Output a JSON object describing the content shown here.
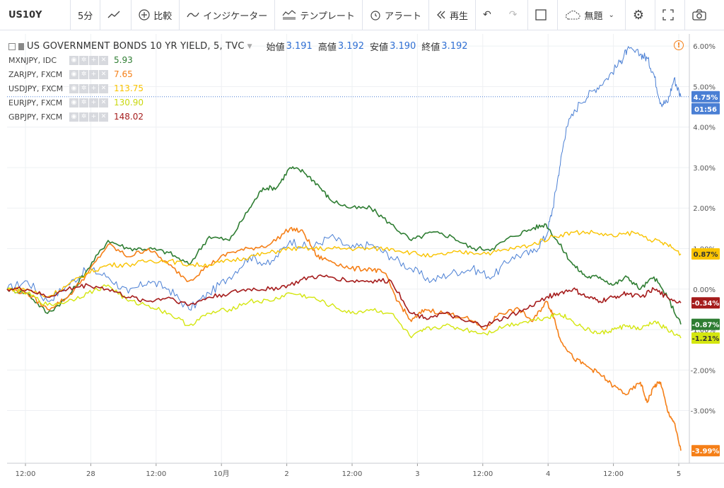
{
  "toolbar": {
    "symbol": "US10Y",
    "interval": "5分",
    "compare": "比較",
    "indicators": "インジケーター",
    "templates": "テンプレート",
    "alert": "アラート",
    "replay": "再生",
    "layout": "無題"
  },
  "legend": {
    "title": "US GOVERNMENT BONDS 10 YR YIELD, 5, TVC",
    "open_label": "始値",
    "open": "3.191",
    "high_label": "高値",
    "high": "3.192",
    "low_label": "安値",
    "low": "3.190",
    "close_label": "終値",
    "close": "3.192"
  },
  "comparisons": [
    {
      "name": "MXNJPY, IDC",
      "value": "5.93",
      "color": "#2e7d32"
    },
    {
      "name": "ZARJPY, FXCM",
      "value": "7.65",
      "color": "#f57f17"
    },
    {
      "name": "USDJPY, FXCM",
      "value": "113.75",
      "color": "#f9c300"
    },
    {
      "name": "EURJPY, FXCM",
      "value": "130.90",
      "color": "#d4e60f"
    },
    {
      "name": "GBPJPY, FXCM",
      "value": "148.02",
      "color": "#a51c1c"
    }
  ],
  "chart_data": {
    "type": "line",
    "x_ticks": [
      "12:00",
      "28",
      "12:00",
      "10月",
      "2",
      "12:00",
      "3",
      "12:00",
      "4",
      "12:00",
      "5"
    ],
    "y_ticks": [
      "6.00%",
      "5.00%",
      "4.00%",
      "3.00%",
      "2.00%",
      "1.00%",
      "0.00%",
      "-1.00%",
      "-2.00%",
      "-3.00%"
    ],
    "ylim": [
      -4.3,
      6.3
    ],
    "xlim": [
      0,
      100
    ],
    "badges": {
      "last_price_time": "01:56"
    },
    "series": [
      {
        "key": "us10y",
        "color": "#4a7fd4",
        "width": 1,
        "last_label": "4.75%",
        "points": [
          [
            0,
            0
          ],
          [
            3,
            0.2
          ],
          [
            6,
            -0.3
          ],
          [
            9,
            0.1
          ],
          [
            12,
            0.5
          ],
          [
            15,
            0.3
          ],
          [
            18,
            -0.1
          ],
          [
            21,
            0.2
          ],
          [
            24,
            0.0
          ],
          [
            27,
            -0.5
          ],
          [
            30,
            -0.1
          ],
          [
            33,
            0.3
          ],
          [
            36,
            0.8
          ],
          [
            39,
            0.6
          ],
          [
            42,
            1.2
          ],
          [
            45,
            1.0
          ],
          [
            48,
            1.3
          ],
          [
            51,
            1.0
          ],
          [
            54,
            1.1
          ],
          [
            57,
            0.8
          ],
          [
            60,
            0.5
          ],
          [
            63,
            0.2
          ],
          [
            66,
            0.4
          ],
          [
            69,
            0.5
          ],
          [
            72,
            0.3
          ],
          [
            75,
            0.8
          ],
          [
            78,
            0.9
          ],
          [
            80,
            1.3
          ],
          [
            81,
            2.0
          ],
          [
            82,
            3.0
          ],
          [
            83,
            4.0
          ],
          [
            85,
            4.6
          ],
          [
            87,
            4.9
          ],
          [
            89,
            5.2
          ],
          [
            91,
            5.6
          ],
          [
            92,
            5.9
          ],
          [
            94,
            5.8
          ],
          [
            95,
            5.7
          ],
          [
            96,
            5.3
          ],
          [
            97,
            4.6
          ],
          [
            98,
            4.6
          ],
          [
            99,
            5.2
          ],
          [
            100,
            4.75
          ]
        ]
      },
      {
        "key": "mxnjpy",
        "color": "#2e7d32",
        "width": 1.6,
        "last_label": "-0.87%",
        "points": [
          [
            0,
            0
          ],
          [
            3,
            -0.1
          ],
          [
            6,
            -0.6
          ],
          [
            9,
            -0.2
          ],
          [
            12,
            0.5
          ],
          [
            15,
            1.2
          ],
          [
            18,
            1.0
          ],
          [
            21,
            1.0
          ],
          [
            24,
            0.9
          ],
          [
            27,
            0.6
          ],
          [
            30,
            1.3
          ],
          [
            33,
            1.2
          ],
          [
            36,
            2.0
          ],
          [
            38,
            2.5
          ],
          [
            40,
            2.5
          ],
          [
            42,
            3.0
          ],
          [
            44,
            2.9
          ],
          [
            46,
            2.6
          ],
          [
            48,
            2.2
          ],
          [
            51,
            2.0
          ],
          [
            54,
            2.0
          ],
          [
            57,
            1.6
          ],
          [
            60,
            1.2
          ],
          [
            63,
            1.4
          ],
          [
            66,
            1.3
          ],
          [
            69,
            1.0
          ],
          [
            72,
            1.0
          ],
          [
            75,
            1.3
          ],
          [
            78,
            1.5
          ],
          [
            80,
            1.6
          ],
          [
            82,
            1.1
          ],
          [
            84,
            0.6
          ],
          [
            86,
            0.3
          ],
          [
            88,
            0.3
          ],
          [
            90,
            0.1
          ],
          [
            92,
            0.3
          ],
          [
            94,
            0.0
          ],
          [
            96,
            0.3
          ],
          [
            98,
            -0.2
          ],
          [
            100,
            -0.87
          ]
        ]
      },
      {
        "key": "zarjpy",
        "color": "#f57f17",
        "width": 1.6,
        "last_label": "-3.99%",
        "points": [
          [
            0,
            0
          ],
          [
            3,
            -0.1
          ],
          [
            6,
            -0.5
          ],
          [
            9,
            -0.2
          ],
          [
            12,
            0.4
          ],
          [
            15,
            1.1
          ],
          [
            18,
            0.8
          ],
          [
            21,
            1.0
          ],
          [
            24,
            0.6
          ],
          [
            27,
            0.2
          ],
          [
            30,
            0.6
          ],
          [
            33,
            0.9
          ],
          [
            36,
            1.0
          ],
          [
            39,
            1.1
          ],
          [
            42,
            1.5
          ],
          [
            44,
            1.4
          ],
          [
            46,
            0.8
          ],
          [
            48,
            0.7
          ],
          [
            51,
            0.5
          ],
          [
            54,
            0.5
          ],
          [
            56,
            0.4
          ],
          [
            58,
            -0.3
          ],
          [
            60,
            -0.8
          ],
          [
            62,
            -0.5
          ],
          [
            65,
            -0.6
          ],
          [
            68,
            -0.7
          ],
          [
            71,
            -1.0
          ],
          [
            73,
            -0.6
          ],
          [
            76,
            -0.5
          ],
          [
            78,
            -0.8
          ],
          [
            80,
            -0.3
          ],
          [
            81,
            -0.6
          ],
          [
            82,
            -1.2
          ],
          [
            84,
            -1.7
          ],
          [
            86,
            -1.9
          ],
          [
            88,
            -2.1
          ],
          [
            90,
            -2.4
          ],
          [
            92,
            -2.6
          ],
          [
            94,
            -2.3
          ],
          [
            95,
            -2.8
          ],
          [
            96,
            -2.4
          ],
          [
            97,
            -2.3
          ],
          [
            98,
            -3.0
          ],
          [
            99,
            -3.3
          ],
          [
            100,
            -3.99
          ]
        ]
      },
      {
        "key": "usdjpy",
        "color": "#f9c300",
        "width": 1.4,
        "last_label": "0.87%",
        "points": [
          [
            0,
            0
          ],
          [
            3,
            0.0
          ],
          [
            6,
            -0.2
          ],
          [
            9,
            0.1
          ],
          [
            12,
            0.4
          ],
          [
            15,
            0.6
          ],
          [
            18,
            0.6
          ],
          [
            21,
            0.7
          ],
          [
            24,
            0.7
          ],
          [
            27,
            0.6
          ],
          [
            30,
            0.6
          ],
          [
            33,
            0.7
          ],
          [
            36,
            0.8
          ],
          [
            39,
            0.9
          ],
          [
            42,
            1.0
          ],
          [
            45,
            1.0
          ],
          [
            48,
            1.0
          ],
          [
            51,
            1.0
          ],
          [
            54,
            1.0
          ],
          [
            57,
            1.0
          ],
          [
            60,
            0.9
          ],
          [
            63,
            0.8
          ],
          [
            66,
            0.9
          ],
          [
            69,
            0.9
          ],
          [
            72,
            0.9
          ],
          [
            75,
            1.0
          ],
          [
            78,
            1.1
          ],
          [
            81,
            1.3
          ],
          [
            84,
            1.4
          ],
          [
            87,
            1.4
          ],
          [
            90,
            1.3
          ],
          [
            93,
            1.4
          ],
          [
            96,
            1.2
          ],
          [
            98,
            1.1
          ],
          [
            100,
            0.87
          ]
        ]
      },
      {
        "key": "eurjpy",
        "color": "#d4e60f",
        "width": 1.4,
        "last_label": "-1.21%",
        "points": [
          [
            0,
            0
          ],
          [
            3,
            -0.1
          ],
          [
            6,
            -0.4
          ],
          [
            9,
            -0.3
          ],
          [
            12,
            -0.1
          ],
          [
            15,
            0.1
          ],
          [
            18,
            -0.3
          ],
          [
            21,
            -0.4
          ],
          [
            24,
            -0.6
          ],
          [
            27,
            -0.9
          ],
          [
            30,
            -0.6
          ],
          [
            33,
            -0.5
          ],
          [
            36,
            -0.3
          ],
          [
            39,
            -0.3
          ],
          [
            42,
            -0.1
          ],
          [
            45,
            -0.2
          ],
          [
            48,
            -0.4
          ],
          [
            51,
            -0.6
          ],
          [
            54,
            -0.5
          ],
          [
            57,
            -0.6
          ],
          [
            60,
            -1.2
          ],
          [
            62,
            -1.0
          ],
          [
            65,
            -0.9
          ],
          [
            68,
            -1.0
          ],
          [
            71,
            -1.1
          ],
          [
            74,
            -0.9
          ],
          [
            77,
            -0.8
          ],
          [
            80,
            -0.7
          ],
          [
            82,
            -0.6
          ],
          [
            84,
            -0.8
          ],
          [
            86,
            -1.0
          ],
          [
            88,
            -1.1
          ],
          [
            90,
            -1.0
          ],
          [
            92,
            -0.9
          ],
          [
            94,
            -1.0
          ],
          [
            96,
            -0.8
          ],
          [
            98,
            -1.0
          ],
          [
            100,
            -1.21
          ]
        ]
      },
      {
        "key": "gbpjpy",
        "color": "#a51c1c",
        "width": 1.6,
        "last_label": "-0.34%",
        "points": [
          [
            0,
            0
          ],
          [
            3,
            0.0
          ],
          [
            6,
            -0.2
          ],
          [
            9,
            0.0
          ],
          [
            12,
            0.1
          ],
          [
            15,
            0.0
          ],
          [
            18,
            -0.2
          ],
          [
            21,
            -0.3
          ],
          [
            24,
            -0.2
          ],
          [
            27,
            -0.4
          ],
          [
            30,
            -0.2
          ],
          [
            33,
            -0.1
          ],
          [
            36,
            0.0
          ],
          [
            39,
            0.0
          ],
          [
            42,
            0.1
          ],
          [
            45,
            0.3
          ],
          [
            48,
            0.3
          ],
          [
            51,
            0.2
          ],
          [
            54,
            0.2
          ],
          [
            57,
            0.2
          ],
          [
            60,
            -0.6
          ],
          [
            62,
            -0.7
          ],
          [
            65,
            -0.6
          ],
          [
            68,
            -0.8
          ],
          [
            71,
            -0.9
          ],
          [
            74,
            -0.7
          ],
          [
            77,
            -0.5
          ],
          [
            80,
            -0.2
          ],
          [
            82,
            -0.1
          ],
          [
            84,
            0.0
          ],
          [
            86,
            -0.2
          ],
          [
            88,
            -0.3
          ],
          [
            90,
            -0.2
          ],
          [
            92,
            -0.1
          ],
          [
            94,
            -0.2
          ],
          [
            96,
            0.0
          ],
          [
            98,
            -0.2
          ],
          [
            100,
            -0.34
          ]
        ]
      }
    ]
  }
}
